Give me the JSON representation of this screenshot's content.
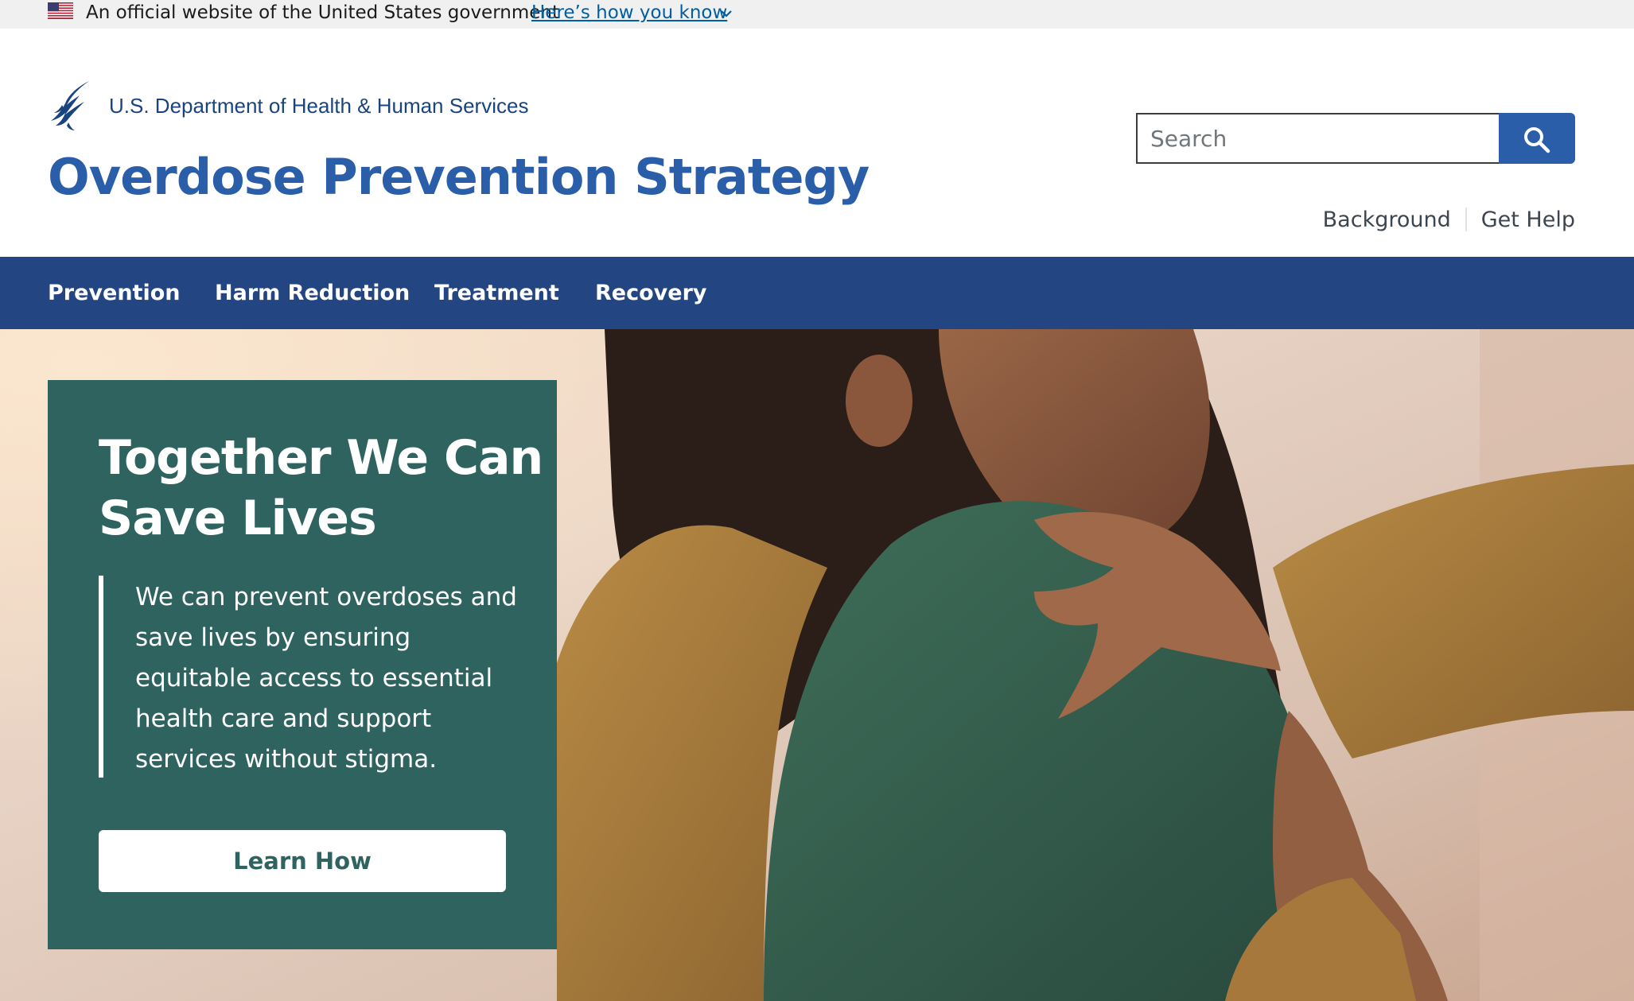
{
  "gov_banner": {
    "text": "An official website of the United States government",
    "link_label": "Here’s how you know"
  },
  "header": {
    "agency_name": "U.S. Department of Health & Human Services",
    "site_title": "Overdose Prevention Strategy",
    "search_placeholder": "Search",
    "utility_links": [
      "Background",
      "Get Help"
    ]
  },
  "nav": {
    "items": [
      "Prevention",
      "Harm Reduction",
      "Treatment",
      "Recovery"
    ]
  },
  "hero": {
    "title": "Together We Can Save Lives",
    "description": "We can prevent overdoses and save lives by ensuring equitable access to essential health care and support services without stigma.",
    "button_label": "Learn How"
  },
  "colors": {
    "primary_blue": "#2a5ea8",
    "nav_blue": "#234682",
    "callout_green": "#2e6360",
    "link_blue": "#005ea2"
  },
  "icons": [
    "us-flag-icon",
    "chevron-down-icon",
    "hhs-eagle-icon",
    "search-icon"
  ]
}
